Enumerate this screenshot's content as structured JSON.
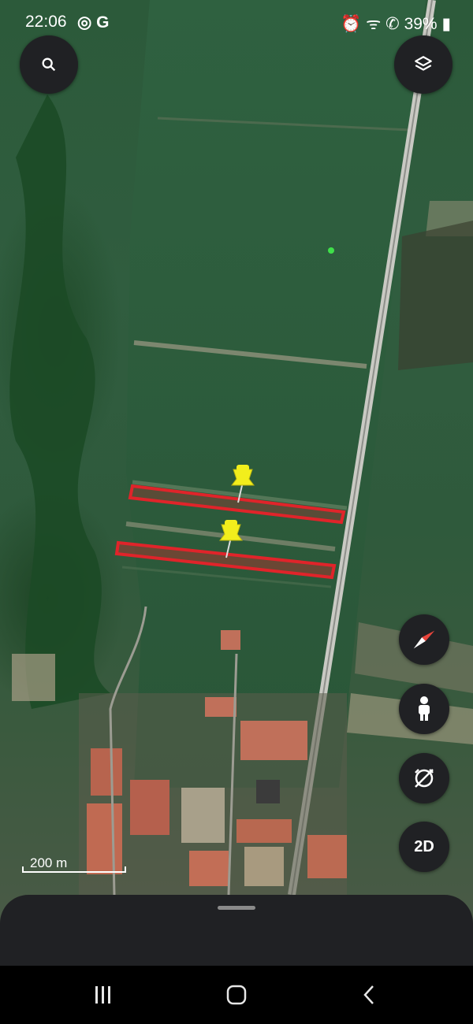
{
  "status_bar": {
    "time": "22:06",
    "left_icons": "◎ G",
    "right_icons": "⏰ ᯤ ✆",
    "battery": "39%"
  },
  "map": {
    "type": "satellite",
    "scale_label": "200 m",
    "polygon_color": "#e0242a",
    "pin_color": "#f2ee1c",
    "pins": [
      "placemark-pin",
      "placemark-pin"
    ]
  },
  "controls": {
    "search_icon": "search-icon",
    "layers_icon": "layers-icon",
    "compass_icon": "compass-icon",
    "street_view_icon": "pegman-icon",
    "rotate_icon": "rotate-lock-icon",
    "view_mode_label": "2D"
  },
  "nav_bar": {
    "recents_icon": "recents-icon",
    "home_icon": "home-icon",
    "back_icon": "back-icon"
  }
}
